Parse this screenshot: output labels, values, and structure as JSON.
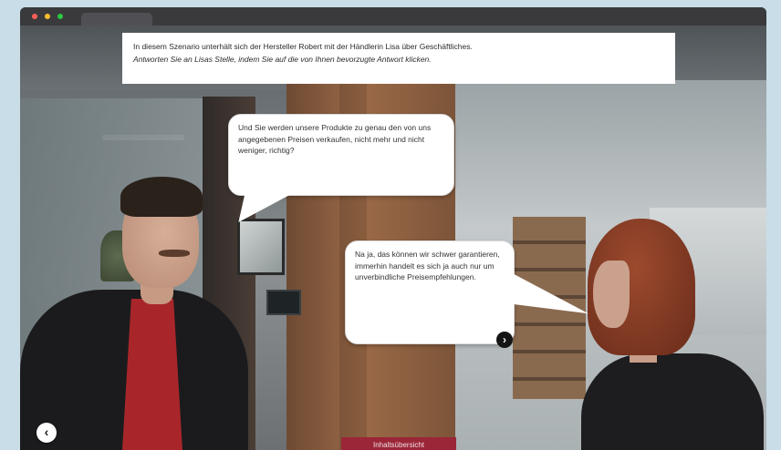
{
  "instruction": {
    "line1": "In diesem Szenario unterhält sich der Hersteller Robert mit der Händlerin Lisa über Geschäftliches.",
    "line2": "Antworten Sie an Lisas Stelle, indem Sie auf die von Ihnen bevorzugte Antwort klicken."
  },
  "dialogue": {
    "robert": "Und Sie werden unsere Produkte zu genau den von uns angegebenen Preisen verkaufen, nicht mehr und nicht weniger, richtig?",
    "lisa": "Na ja, das können wir schwer garantieren, immerhin handelt es sich ja auch nur um unverbindliche Preisempfehlungen."
  },
  "navigation": {
    "next_icon": "chevron-right-icon",
    "back_icon": "chevron-left-icon",
    "overview_label": "Inhaltsübersicht"
  },
  "colors": {
    "overview_button": "#9b2638",
    "speech_bubble": "#ffffff"
  }
}
